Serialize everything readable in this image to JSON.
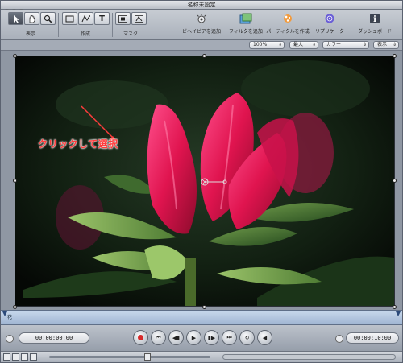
{
  "window": {
    "title": "名称未設定"
  },
  "toolbar": {
    "groups": [
      {
        "label": "表示"
      },
      {
        "label": "作成"
      },
      {
        "label": "マスク"
      }
    ],
    "actions": [
      {
        "label": "ビヘイビアを追加",
        "icon": "gear-sparkle-icon"
      },
      {
        "label": "フィルタを追加",
        "icon": "filter-icon"
      },
      {
        "label": "パーティクルを作成",
        "icon": "particle-icon"
      },
      {
        "label": "リプリケータ",
        "icon": "replicator-icon"
      },
      {
        "label": "ダッシュボード",
        "icon": "info-icon"
      }
    ]
  },
  "options": {
    "zoom": "100%",
    "quality": "最大",
    "color": "カラー",
    "view": "表示"
  },
  "canvas": {
    "annotation": "クリックして選択",
    "accent": "#ff3c3c"
  },
  "timeline": {
    "marker_label": "花"
  },
  "transport": {
    "timecode_current": "00:00:00;00",
    "timecode_duration": "00:00:10;00"
  }
}
